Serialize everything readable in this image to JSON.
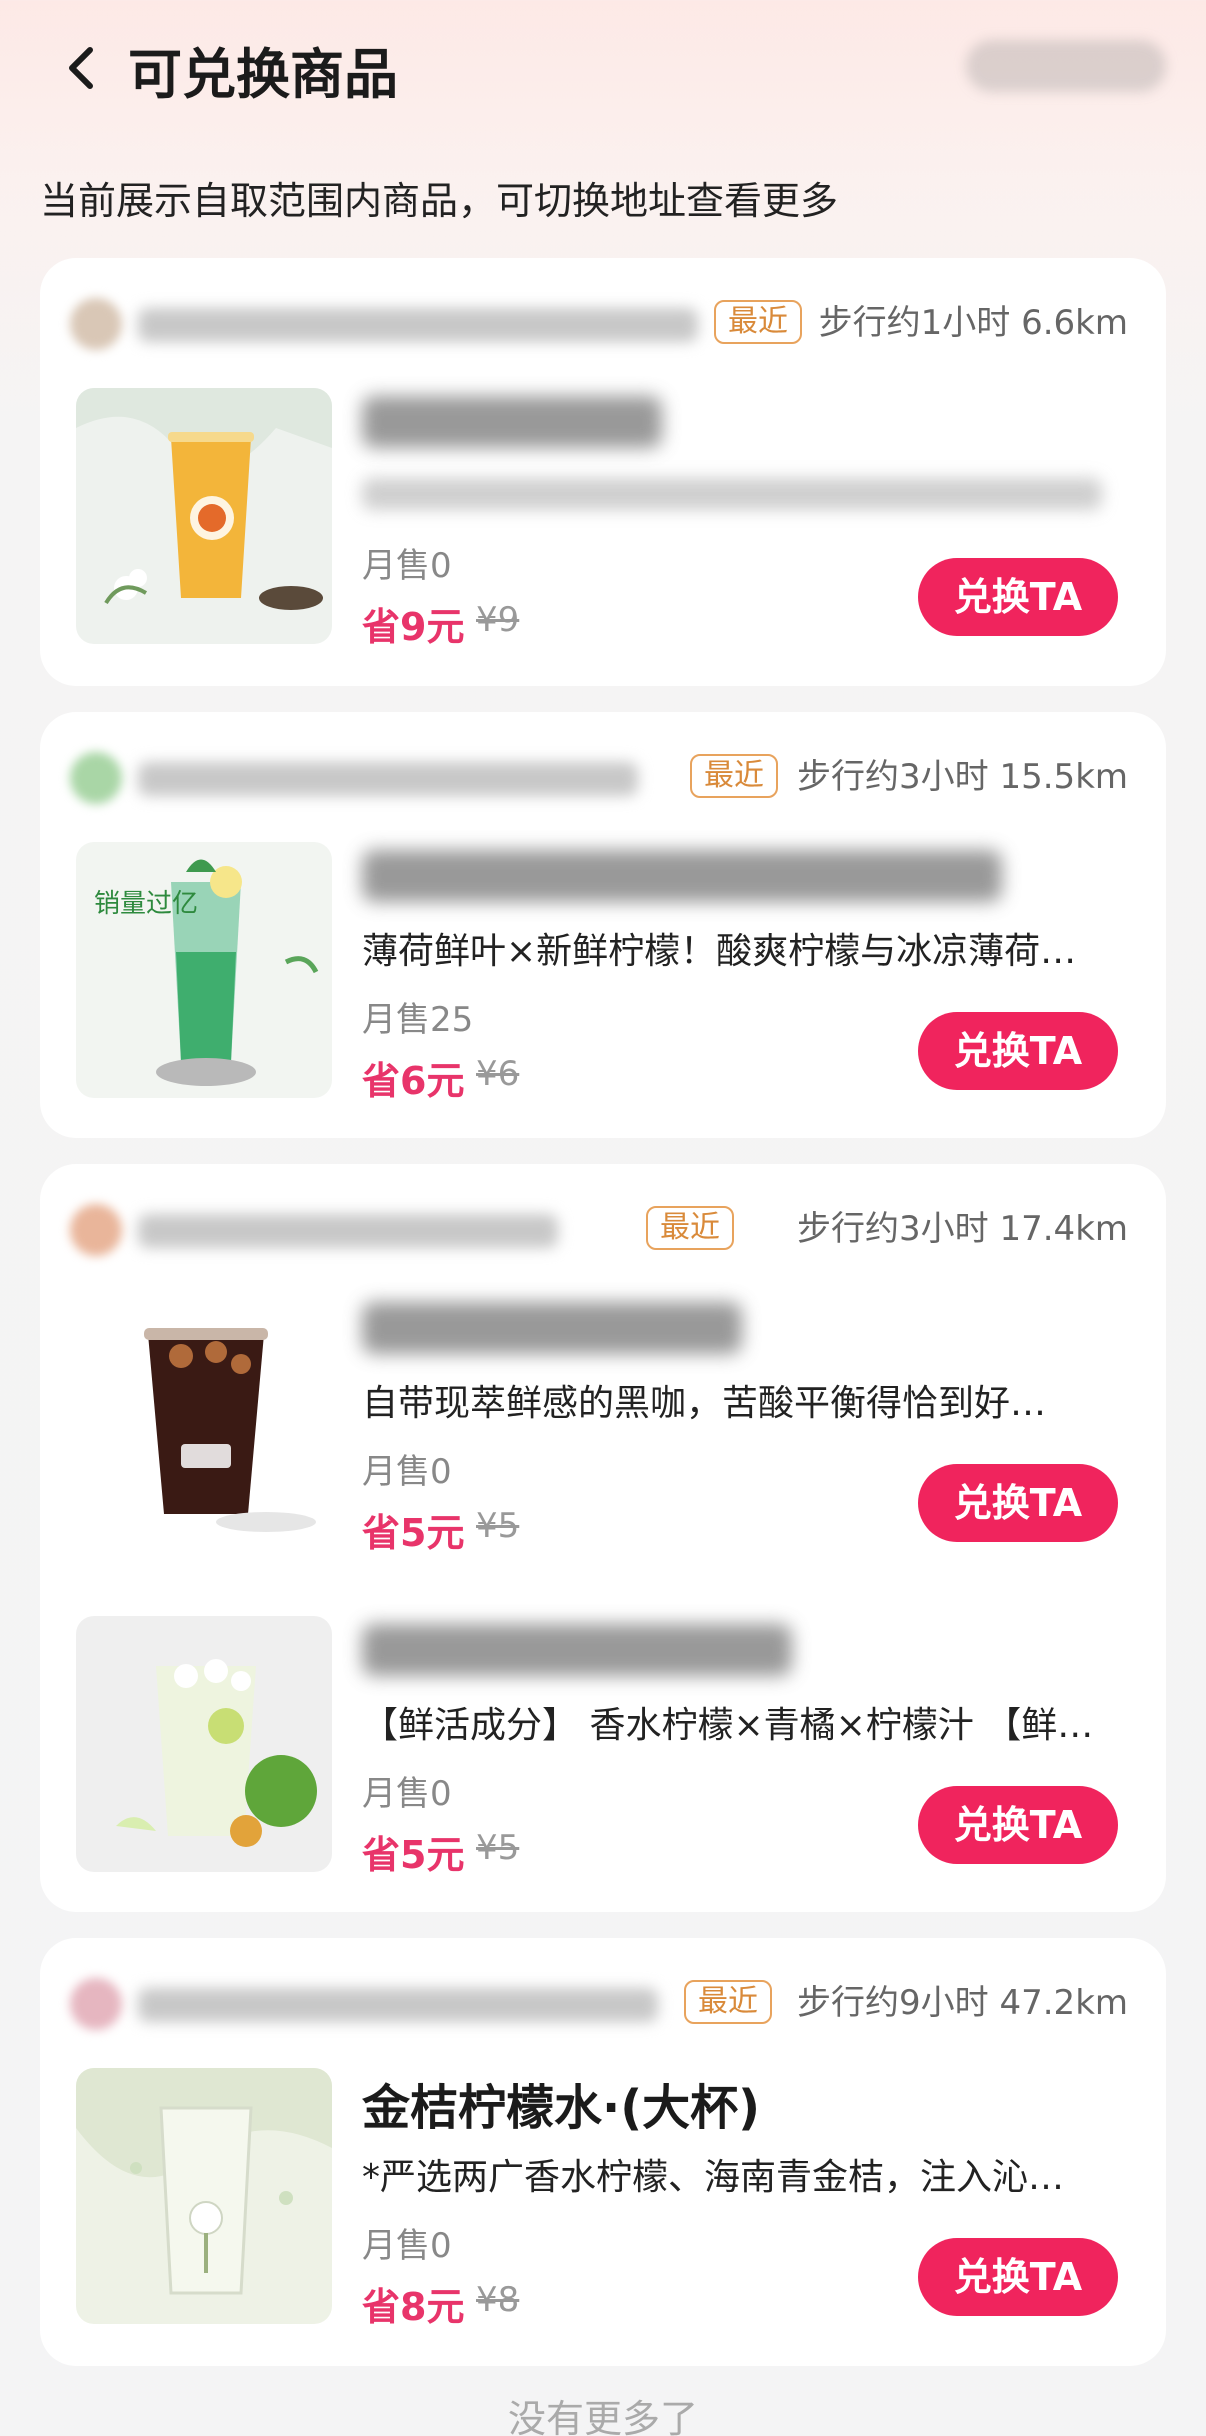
{
  "header": {
    "title": "可兑换商品",
    "switch_address": ""
  },
  "notice": "当前展示自取范围内商品，可切换地址查看更多",
  "stores": [
    {
      "name": "",
      "tag": "最近",
      "distance": "步行约1小时 6.6km",
      "items": [
        {
          "name": "",
          "description": "",
          "sales": "月售0",
          "save": "省9元",
          "original_price": "¥9",
          "button": "兑换TA",
          "thumb_caption": ""
        }
      ]
    },
    {
      "name": "",
      "tag": "最近",
      "distance": "步行约3小时 15.5km",
      "items": [
        {
          "name": "",
          "description": "薄荷鲜叶×新鲜柠檬！酸爽柠檬与冰凉薄荷…",
          "sales": "月售25",
          "save": "省6元",
          "original_price": "¥6",
          "button": "兑换TA",
          "thumb_caption": "销量过亿"
        }
      ]
    },
    {
      "name": "",
      "tag": "最近",
      "distance": "步行约3小时 17.4km",
      "items": [
        {
          "name": "",
          "description": "自带现萃鲜感的黑咖，苦酸平衡得恰到好…",
          "sales": "月售0",
          "save": "省5元",
          "original_price": "¥5",
          "button": "兑换TA",
          "thumb_caption": ""
        },
        {
          "name": "",
          "description": "【鲜活成分】 香水柠檬×青橘×柠檬汁 【鲜…",
          "sales": "月售0",
          "save": "省5元",
          "original_price": "¥5",
          "button": "兑换TA",
          "thumb_caption": ""
        }
      ]
    },
    {
      "name": "",
      "tag": "最近",
      "distance": "步行约9小时 47.2km",
      "items": [
        {
          "name": "金桔柠檬水·(大杯)",
          "description": "*严选两广香水柠檬、海南青金桔，注入沁…",
          "sales": "月售0",
          "save": "省8元",
          "original_price": "¥8",
          "button": "兑换TA",
          "thumb_caption": ""
        }
      ]
    }
  ],
  "footer": "没有更多了",
  "colors": {
    "accent": "#f0245d",
    "tag": "#e8a35d",
    "price": "#e8346a"
  }
}
